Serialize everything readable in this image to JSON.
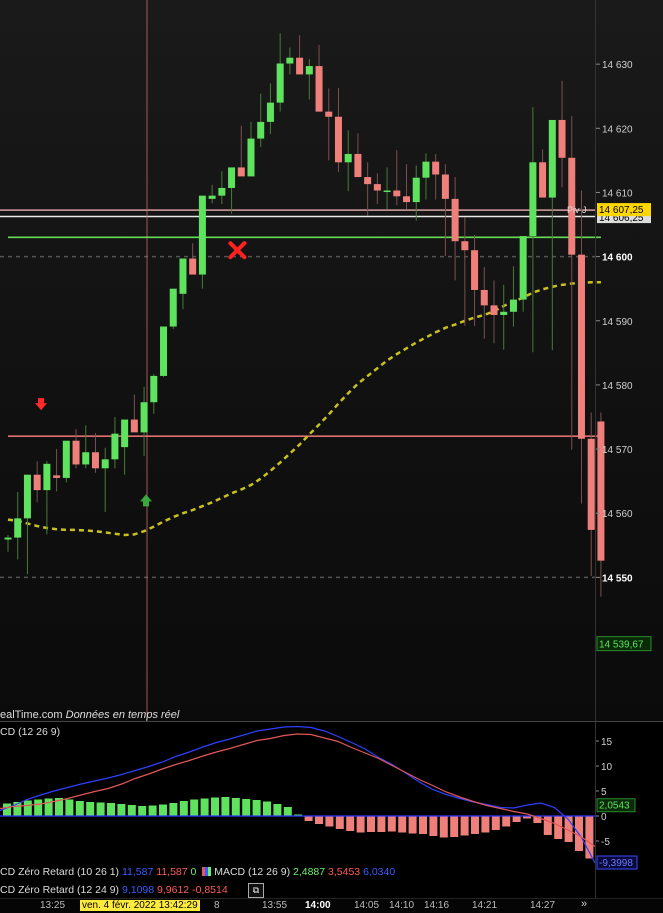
{
  "chart_data": [
    {
      "type": "candlestick",
      "title": "",
      "ylim": [
        14534,
        14640
      ],
      "y_ticks": [
        "14 630",
        "14 620",
        "14 610",
        "14 600",
        "14 590",
        "14 580",
        "14 570",
        "14 560",
        "14 550"
      ],
      "candles": [
        [
          14555.9,
          14556.6,
          14554.0,
          14556.2
        ],
        [
          14556.2,
          14563.3,
          14552.8,
          14559.2
        ],
        [
          14559.2,
          14566.0,
          14550.5,
          14566.0
        ],
        [
          14566.0,
          14568.1,
          14561.7,
          14563.6
        ],
        [
          14563.6,
          14568.1,
          14556.7,
          14567.7
        ],
        [
          14565.9,
          14570.0,
          14563.4,
          14565.5
        ],
        [
          14565.5,
          14570.9,
          14564.8,
          14571.3
        ],
        [
          14571.3,
          14573.1,
          14567.0,
          14567.6
        ],
        [
          14567.6,
          14573.7,
          14567.0,
          14569.5
        ],
        [
          14569.5,
          14572.5,
          14566.3,
          14567.0
        ],
        [
          14567.0,
          14570.2,
          14560.2,
          14568.4
        ],
        [
          14568.4,
          14575.0,
          14567.0,
          14572.4
        ],
        [
          14570.3,
          14573.8,
          14566.0,
          14574.6
        ],
        [
          14574.6,
          14578.5,
          14572.9,
          14572.6
        ],
        [
          14572.6,
          14579.7,
          14568.9,
          14577.3
        ],
        [
          14577.3,
          14581.7,
          14575.5,
          14581.4
        ],
        [
          14581.4,
          14586.7,
          14581.2,
          14589.1
        ],
        [
          14589.1,
          14591.7,
          14588.7,
          14595.0
        ],
        [
          14594.2,
          14597.5,
          14591.8,
          14599.7
        ],
        [
          14599.7,
          14602.1,
          14597.6,
          14597.2
        ],
        [
          14597.2,
          14604.6,
          14595.0,
          14609.5
        ],
        [
          14609.0,
          14611.2,
          14608.3,
          14609.5
        ],
        [
          14609.5,
          14613.3,
          14608.2,
          14610.7
        ],
        [
          14610.7,
          14612.3,
          14606.7,
          14613.9
        ],
        [
          14613.9,
          14620.4,
          14613.2,
          14612.5
        ],
        [
          14612.5,
          14621.0,
          14612.5,
          14618.4
        ],
        [
          14618.4,
          14625.4,
          14617.1,
          14621.0
        ],
        [
          14621.0,
          14627.0,
          14619.1,
          14624.0
        ],
        [
          14624.0,
          14634.8,
          14622.6,
          14630.1
        ],
        [
          14630.1,
          14632.6,
          14628.4,
          14631.0
        ],
        [
          14631.0,
          14634.5,
          14629.4,
          14628.4
        ],
        [
          14628.4,
          14630.8,
          14624.5,
          14629.7
        ],
        [
          14629.7,
          14633.0,
          14625.5,
          14622.6
        ],
        [
          14622.6,
          14626.2,
          14615.0,
          14621.8
        ],
        [
          14621.8,
          14626.3,
          14613.2,
          14614.7
        ],
        [
          14614.7,
          14619.7,
          14610.2,
          14616.0
        ],
        [
          14616.0,
          14619.2,
          14612.7,
          14612.4
        ],
        [
          14612.4,
          14614.7,
          14606.4,
          14611.3
        ],
        [
          14611.3,
          14613.0,
          14608.2,
          14610.3
        ],
        [
          14610.3,
          14613.9,
          14607.4,
          14610.3
        ],
        [
          14610.3,
          14616.6,
          14608.0,
          14609.4
        ],
        [
          14609.4,
          14614.4,
          14607.3,
          14608.5
        ],
        [
          14608.5,
          14614.2,
          14605.6,
          14612.3
        ],
        [
          14612.3,
          14616.1,
          14608.9,
          14614.8
        ],
        [
          14614.8,
          14616.0,
          14608.9,
          14612.8
        ],
        [
          14612.8,
          14614.4,
          14600.1,
          14609.0
        ],
        [
          14609.0,
          14612.4,
          14596.3,
          14602.4
        ],
        [
          14602.4,
          14606.1,
          14589.2,
          14601.0
        ],
        [
          14601.0,
          14603.4,
          14589.2,
          14594.8
        ],
        [
          14594.8,
          14598.4,
          14587.2,
          14592.4
        ],
        [
          14592.4,
          14596.3,
          14586.5,
          14590.9
        ],
        [
          14590.9,
          14595.6,
          14585.5,
          14591.4
        ],
        [
          14591.4,
          14598.5,
          14589.1,
          14593.3
        ],
        [
          14593.3,
          14600.2,
          14591.4,
          14603.2
        ],
        [
          14603.2,
          14623.3,
          14585.1,
          14614.7
        ],
        [
          14614.7,
          14616.7,
          14609.4,
          14609.2
        ],
        [
          14609.2,
          14616.7,
          14585.4,
          14621.3
        ],
        [
          14621.3,
          14627.4,
          14610.8,
          14615.4
        ],
        [
          14615.4,
          14621.9,
          14569.9,
          14600.3
        ],
        [
          14600.3,
          14610.3,
          14561.5,
          14571.6
        ],
        [
          14571.6,
          14575.7,
          14550.2,
          14557.4
        ],
        [
          14574.3,
          14575.7,
          14547.0,
          14552.6
        ]
      ],
      "overlays": [
        {
          "name": "upper-band",
          "color": "#e07070",
          "values": [
            14572,
            14572,
            14572,
            14572,
            14572,
            14572,
            14572,
            14572,
            14572,
            14572,
            14572,
            14572,
            14572,
            14572,
            14572,
            14572,
            14572,
            14572,
            14572,
            14572,
            14572,
            14572,
            14572,
            14572,
            14572,
            14572,
            14572,
            14572,
            14572,
            14572,
            14572,
            14572,
            14572,
            14572,
            14572,
            14572,
            14572,
            14572,
            14572,
            14572,
            14572,
            14572,
            14572,
            14572,
            14572,
            14572,
            14572,
            14572,
            14572,
            14572,
            14572,
            14572,
            14572,
            14572,
            14572,
            14572,
            14572,
            14572,
            14572,
            14572,
            14572,
            14572
          ]
        },
        {
          "name": "trailing-stop",
          "color": "#66dd55",
          "values": [
            14603,
            14603,
            14603,
            14603,
            14603,
            14603,
            14603,
            14603,
            14603,
            14603,
            14603,
            14603,
            14603,
            14603,
            14603,
            14603,
            14603,
            14603,
            14603,
            14603,
            14603,
            14603,
            14603,
            14603,
            14603,
            14603,
            14603,
            14603,
            14603,
            14603,
            14603,
            14603,
            14603,
            14603,
            14603,
            14603,
            14603,
            14603,
            14603,
            14603,
            14603,
            14603,
            14603,
            14603,
            14603,
            14603,
            14603,
            14603,
            14603,
            14603,
            14603,
            14603,
            14603,
            14603,
            14603,
            14603,
            14603,
            14603,
            14603,
            14603,
            14603,
            14603
          ]
        },
        {
          "name": "moving-average",
          "color": "#c9c21e",
          "dashed": true,
          "values": [
            14559.0,
            14558.8,
            14558.4,
            14558.0,
            14557.7,
            14557.5,
            14557.4,
            14557.4,
            14557.3,
            14557.2,
            14557.0,
            14556.8,
            14556.6,
            14556.7,
            14557.2,
            14557.9,
            14558.7,
            14559.4,
            14560.0,
            14560.5,
            14561.1,
            14561.7,
            14562.4,
            14563.1,
            14563.7,
            14564.4,
            14565.4,
            14566.6,
            14567.9,
            14569.3,
            14570.7,
            14572.3,
            14573.8,
            14575.4,
            14577.1,
            14578.7,
            14580.2,
            14581.4,
            14582.6,
            14583.8,
            14584.8,
            14585.7,
            14586.6,
            14587.4,
            14588.2,
            14588.9,
            14589.4,
            14590.0,
            14590.5,
            14590.9,
            14591.5,
            14592.3,
            14593.0,
            14593.6,
            14594.4,
            14594.9,
            14595.3,
            14595.6,
            14595.8,
            14595.9,
            14596.0,
            14596.0
          ]
        }
      ],
      "horizontal_lines": [
        {
          "label": "Piv J",
          "value": 14607.25,
          "badge": "14 607,25",
          "color": "#ffd700"
        },
        {
          "value": 14606.25,
          "badge": "14 606,25"
        },
        {
          "value": 14600,
          "dashed": true
        },
        {
          "value": 14550,
          "dashed": true
        }
      ],
      "last_value_badge": "14 539,67",
      "markers": [
        {
          "type": "down-arrow",
          "color": "#ff2a2a",
          "at_price": 14577
        },
        {
          "type": "up-arrow",
          "color": "#3aa83a",
          "at_price": 14562
        },
        {
          "type": "cross",
          "color": "#ff2020",
          "at_price": 14601
        }
      ]
    },
    {
      "type": "histogram+line",
      "title": "CD (12 26 9)",
      "ylim": [
        -12,
        18
      ],
      "y_ticks": [
        "15",
        "10",
        "5",
        "0",
        "-5"
      ],
      "histogram": [
        [
          0,
          2.5
        ],
        [
          1,
          2.8
        ],
        [
          2,
          3.1
        ],
        [
          3,
          3.3
        ],
        [
          4,
          3.5
        ],
        [
          5,
          3.6
        ],
        [
          6,
          3.3
        ],
        [
          7,
          3.0
        ],
        [
          8,
          2.8
        ],
        [
          9,
          2.7
        ],
        [
          10,
          2.6
        ],
        [
          11,
          2.4
        ],
        [
          12,
          2.2
        ],
        [
          13,
          2.0
        ],
        [
          14,
          2.1
        ],
        [
          15,
          2.3
        ],
        [
          16,
          2.6
        ],
        [
          17,
          3.0
        ],
        [
          18,
          3.3
        ],
        [
          19,
          3.5
        ],
        [
          20,
          3.7
        ],
        [
          21,
          3.8
        ],
        [
          22,
          3.6
        ],
        [
          23,
          3.4
        ],
        [
          24,
          3.2
        ],
        [
          25,
          2.9
        ],
        [
          26,
          2.4
        ],
        [
          27,
          1.8
        ],
        [
          28,
          0.3
        ],
        [
          29,
          -1.0
        ],
        [
          30,
          -1.6
        ],
        [
          31,
          -2.1
        ],
        [
          32,
          -2.6
        ],
        [
          33,
          -3.0
        ],
        [
          34,
          -3.3
        ],
        [
          35,
          -3.2
        ],
        [
          36,
          -3.2
        ],
        [
          37,
          -3.1
        ],
        [
          38,
          -3.3
        ],
        [
          39,
          -3.5
        ],
        [
          40,
          -3.6
        ],
        [
          41,
          -4.0
        ],
        [
          42,
          -4.3
        ],
        [
          43,
          -4.2
        ],
        [
          44,
          -3.9
        ],
        [
          45,
          -3.6
        ],
        [
          46,
          -3.3
        ],
        [
          47,
          -2.8
        ],
        [
          48,
          -2.1
        ],
        [
          49,
          -1.2
        ],
        [
          50,
          -0.5
        ],
        [
          51,
          -1.4
        ],
        [
          52,
          -3.8
        ],
        [
          53,
          -4.6
        ],
        [
          54,
          -5.2
        ],
        [
          55,
          -7.0
        ],
        [
          56,
          -8.5
        ]
      ],
      "lines": [
        {
          "name": "macd",
          "color": "#2f3fff",
          "values": [
            1.1,
            2.1,
            3.3,
            4.2,
            5.0,
            5.7,
            6.4,
            7.0,
            7.6,
            8.3,
            9.1,
            9.9,
            10.8,
            11.9,
            12.8,
            13.8,
            14.7,
            15.4,
            16.2,
            17.0,
            17.4,
            17.8,
            17.9,
            17.7,
            17.0,
            15.9,
            14.7,
            13.4,
            11.7,
            10.3,
            8.6,
            6.8,
            5.3,
            4.3,
            3.5,
            2.8,
            2.3,
            1.7,
            1.6,
            2.2,
            2.6,
            1.7,
            -0.6,
            -4.3,
            -9.4
          ]
        },
        {
          "name": "signal",
          "color": "#e05858",
          "values": [
            1.5,
            1.9,
            2.1,
            2.4,
            2.9,
            3.5,
            4.2,
            4.9,
            5.5,
            6.4,
            7.5,
            8.4,
            9.4,
            10.3,
            11.1,
            12.0,
            12.8,
            13.5,
            14.3,
            15.1,
            15.5,
            16.1,
            16.4,
            16.3,
            15.6,
            14.9,
            13.7,
            12.6,
            11.5,
            10.1,
            8.7,
            7.3,
            6.1,
            4.8,
            3.8,
            2.9,
            2.1,
            1.5,
            0.9,
            0.4,
            -0.5,
            -1.5,
            -2.8,
            -4.2,
            -6.1
          ]
        }
      ],
      "badges": [
        "2,0543",
        "-9,3998"
      ]
    }
  ],
  "price_panel": {
    "source": "ealTime.com",
    "source_suffix": "Données en temps réel",
    "piv_label": "Piv J",
    "badges": {
      "piv": "14 607,25",
      "hline": "14 606,25",
      "last": "14 539,67"
    }
  },
  "macd_panel": {
    "title": "CD (12 26 9)",
    "label1": "CD Zéro Retard (10 26 1)",
    "label1_v1": "11,587",
    "label1_v2": "11,587",
    "label1_v3": "0",
    "label1_macd": "MACD (12 26 9)",
    "label1_macd_v1": "2,4887",
    "label1_macd_v2": "3,5453",
    "label1_macd_v3": "6,0340",
    "label2": "CD Zéro Retard (12 24 9)",
    "label2_v1": "9,1098",
    "label2_v2": "9,9612",
    "label2_v3": "-0,8514",
    "badge_top": "2,0543",
    "badge_bottom": "-9,3998"
  },
  "time_axis": {
    "labels": [
      "13:25",
      "13:55",
      "14:00",
      "14:05",
      "14:10",
      "14:16",
      "14:21",
      "14:27"
    ],
    "cursor": "ven. 4 févr. 2022 13:42:29",
    "cursor_suffix": "8"
  },
  "colors": {
    "bull": "#5fe35f",
    "bear": "#ef7f7a",
    "badge_yellow": "#ffd700",
    "last_badge_green": "#1f6f1f"
  },
  "icons": [
    "window-icon",
    "double-chevron-right-icon"
  ]
}
